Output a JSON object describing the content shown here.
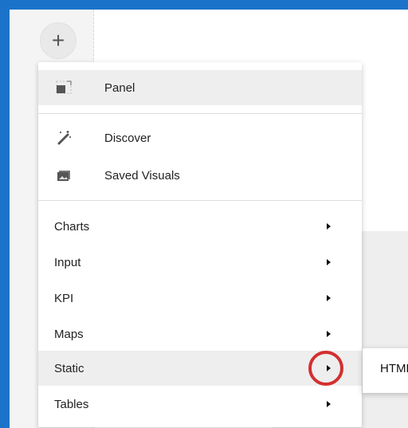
{
  "toolbar": {
    "add_button_label": "+"
  },
  "menu": {
    "top_items": [
      {
        "label": "Panel",
        "icon": "panel-icon"
      },
      {
        "label": "Discover",
        "icon": "magic-wand-icon"
      },
      {
        "label": "Saved Visuals",
        "icon": "saved-visuals-icon"
      }
    ],
    "sections": [
      {
        "label": "Charts",
        "has_submenu": true
      },
      {
        "label": "Input",
        "has_submenu": true
      },
      {
        "label": "KPI",
        "has_submenu": true
      },
      {
        "label": "Maps",
        "has_submenu": true
      },
      {
        "label": "Static",
        "has_submenu": true,
        "active": true
      },
      {
        "label": "Tables",
        "has_submenu": true
      }
    ]
  },
  "submenu": {
    "items": [
      {
        "label": "HTML"
      }
    ]
  },
  "colors": {
    "window_border": "#1a73c9",
    "active_row": "#eeeeee",
    "highlight_circle": "#d32f2f"
  }
}
